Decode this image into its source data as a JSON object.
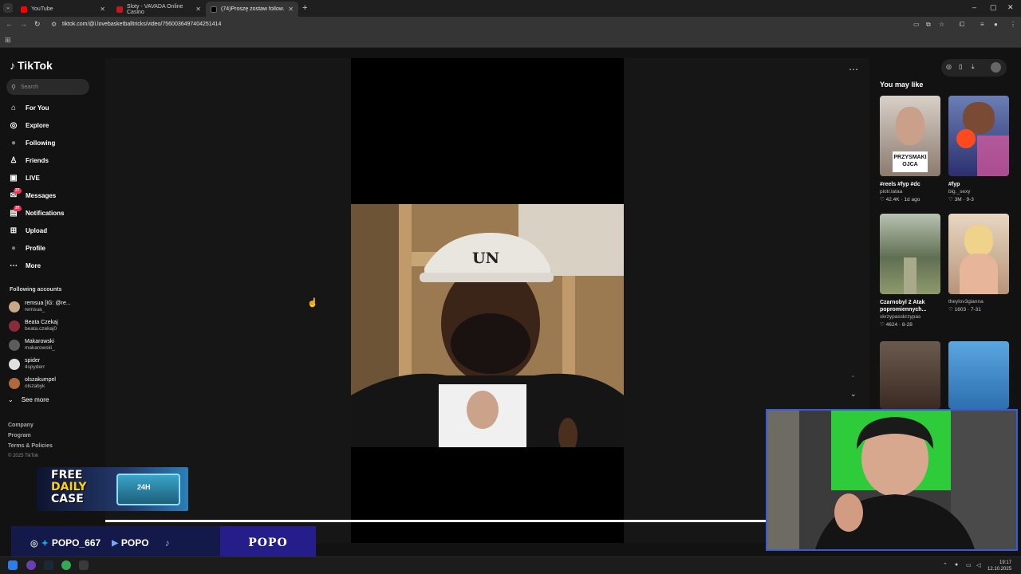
{
  "browser": {
    "tabs": [
      {
        "title": "YouTube",
        "color": "#ff0000"
      },
      {
        "title": "Sloty - VAVADA Online Casino",
        "color": "#c21a1a"
      },
      {
        "title": "(74)Proszę zostaw follow. popo...",
        "color": "#000000"
      }
    ],
    "url": "tiktok.com/@i.lovebasketballtricks/video/7560036497404251414",
    "window_controls": {
      "minimize": "–",
      "maximize": "▢",
      "close": "✕"
    }
  },
  "sidebar": {
    "logo": "TikTok",
    "search_placeholder": "Search",
    "nav": [
      {
        "label": "For You",
        "icon": "home-icon",
        "glyph": "⌂"
      },
      {
        "label": "Explore",
        "icon": "compass-icon",
        "glyph": "◎"
      },
      {
        "label": "Following",
        "icon": "following-avatar-icon",
        "glyph": "●"
      },
      {
        "label": "Friends",
        "icon": "friends-icon",
        "glyph": "♙"
      },
      {
        "label": "LIVE",
        "icon": "live-icon",
        "glyph": "▣"
      },
      {
        "label": "Messages",
        "icon": "messages-icon",
        "glyph": "✉",
        "badge": "27"
      },
      {
        "label": "Notifications",
        "icon": "notifications-icon",
        "glyph": "▤",
        "badge": "37"
      },
      {
        "label": "Upload",
        "icon": "upload-icon",
        "glyph": "⊞"
      },
      {
        "label": "Profile",
        "icon": "profile-avatar-icon",
        "glyph": "●"
      },
      {
        "label": "More",
        "icon": "more-icon",
        "glyph": "⋯"
      }
    ],
    "following_title": "Following accounts",
    "following_accounts": [
      {
        "name": "remsua [IG: @re...",
        "username": "remsua_",
        "color": "#c9a88a"
      },
      {
        "name": "Beata Czekaj",
        "username": "beata.czekaj0",
        "color": "#8a2b3a"
      },
      {
        "name": "Makarowski",
        "username": "makarowski_",
        "color": "#5c5c5c"
      },
      {
        "name": "spider",
        "username": "4spyderr",
        "color": "#e0e0e0"
      },
      {
        "name": "olszakumpel",
        "username": "olszabyk",
        "color": "#b0683f"
      }
    ],
    "see_more": "See more",
    "footer": [
      "Company",
      "Program",
      "Terms & Policies"
    ],
    "copyright": "© 2025 TikTok"
  },
  "right_panel": {
    "title": "You may like",
    "videos": [
      {
        "caption": "#reels #fyp #dc",
        "author": "piotr.lataa",
        "likes": "42.4K",
        "date": "1d ago",
        "overlay": "PRZYSMAKI OJCA"
      },
      {
        "caption": "#fyp",
        "author": "big._sexy",
        "likes": "3M",
        "date": "9-3"
      },
      {
        "caption": "Czarnobyl 2 Atak popromiennych...",
        "author": "skrzypasskrzypas",
        "likes": "4624",
        "date": "8-28"
      },
      {
        "caption": "",
        "author": "theylov3gianna",
        "likes": "1603",
        "date": "7-31"
      }
    ]
  },
  "video": {
    "cap_text": "UN"
  },
  "overlays": {
    "promo_line1": "FREE",
    "promo_line2": "DAILY",
    "promo_line3": "CASE",
    "promo_badge": "24H",
    "social_handle1": "POPO_667",
    "social_handle2": "POPO",
    "brand": "POPO"
  },
  "taskbar": {
    "time": "19:17",
    "date": "12.10.2025"
  }
}
